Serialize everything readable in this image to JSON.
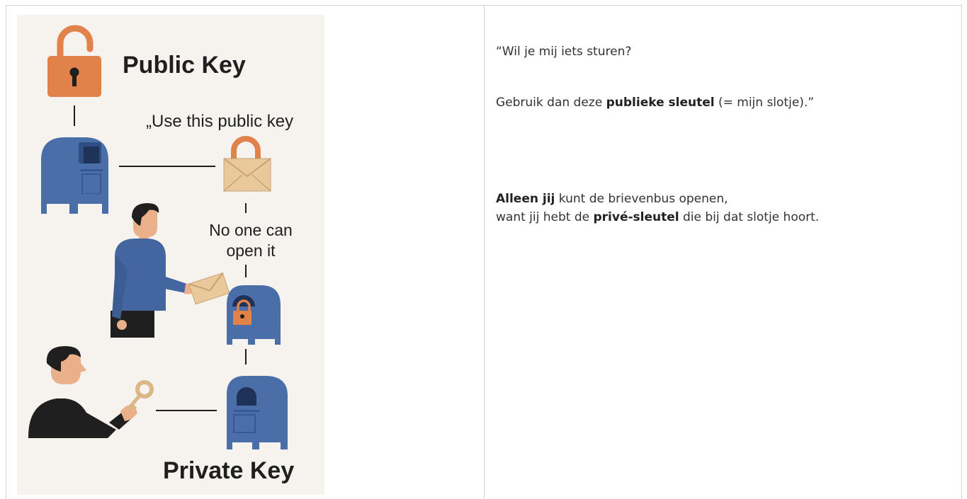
{
  "illustration": {
    "title_public": "Public Key",
    "caption_use": "„Use this public key",
    "caption_noone": "No one can open it",
    "title_private": "Private Key"
  },
  "text": {
    "line1": "“Wil je mij iets sturen?",
    "line2_pre": "Gebruik dan deze ",
    "line2_bold": "publieke sleutel",
    "line2_post": " (= mijn slotje).”",
    "line3_bold": "Alleen jij",
    "line3_post": " kunt de brievenbus openen,",
    "line4_pre": "want jij hebt de ",
    "line4_bold": "privé-sleutel",
    "line4_post": " die bij dat slotje hoort."
  },
  "colors": {
    "lock_orange": "#e0824a",
    "mailbox_blue": "#4a6fa8",
    "envelope_tan": "#e9c99a",
    "panel_bg": "#f6f3ee",
    "shirt_blue": "#4466a0",
    "grid_line": "#d4d4d4"
  }
}
